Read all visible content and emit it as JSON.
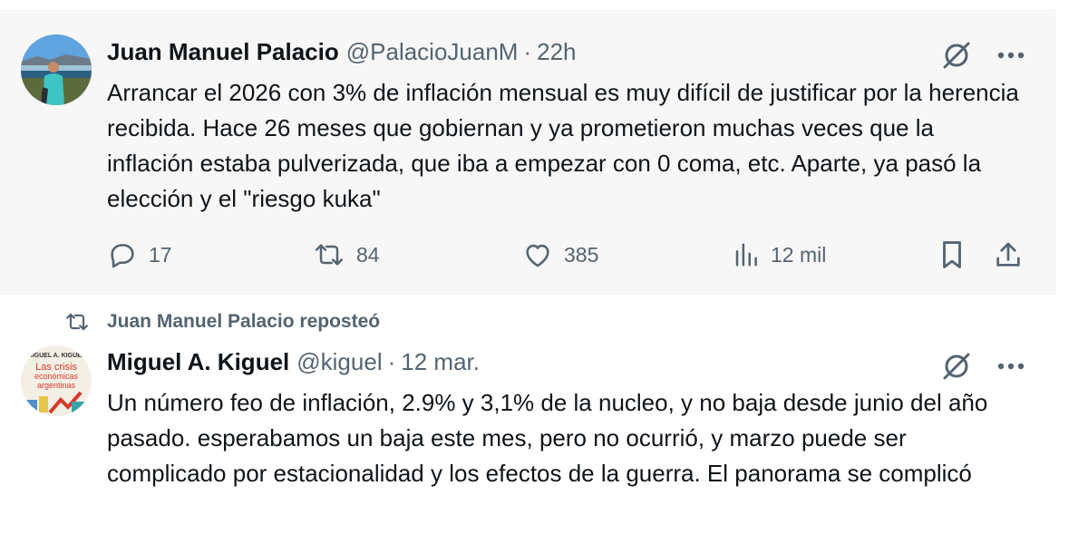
{
  "colors": {
    "text": "#0f1419",
    "secondary": "#536471",
    "bg_highlight": "#f7f7f7",
    "border": "#eff3f4"
  },
  "tweet1": {
    "author_name": "Juan Manuel Palacio",
    "handle": "@PalacioJuanM",
    "separator": "·",
    "time": "22h",
    "text": "Arrancar el 2026 con 3% de inflación mensual es muy difícil de justificar por la herencia recibida. Hace 26 meses que gobiernan y ya prometieron muchas veces que la inflación estaba pulverizada, que iba a empezar con 0 coma, etc. Aparte, ya pasó la elección y el \"riesgo kuka\"",
    "replies": "17",
    "reposts": "84",
    "likes": "385",
    "views": "12 mil",
    "icons": [
      "grok-icon",
      "more-icon",
      "reply-icon",
      "repost-icon",
      "like-icon",
      "views-icon",
      "bookmark-icon",
      "share-icon"
    ]
  },
  "repost_banner": {
    "text": "Juan Manuel Palacio reposteó"
  },
  "tweet2": {
    "author_name": "Miguel A. Kiguel",
    "handle": "@kiguel",
    "separator": "·",
    "time": "12 mar.",
    "text": "Un número feo de inflación, 2.9% y 3,1% de la nucleo, y no baja desde junio del año pasado.  esperabamos un baja este mes, pero no ocurrió, y marzo puede ser complicado por estacionalidad y los efectos de la guerra. El panorama se complicó",
    "avatar_logo": {
      "line1": "MIGUEL A. KIGUEL",
      "line2": "Las crisis",
      "line3": "económicas",
      "line4": "argentinas"
    }
  }
}
